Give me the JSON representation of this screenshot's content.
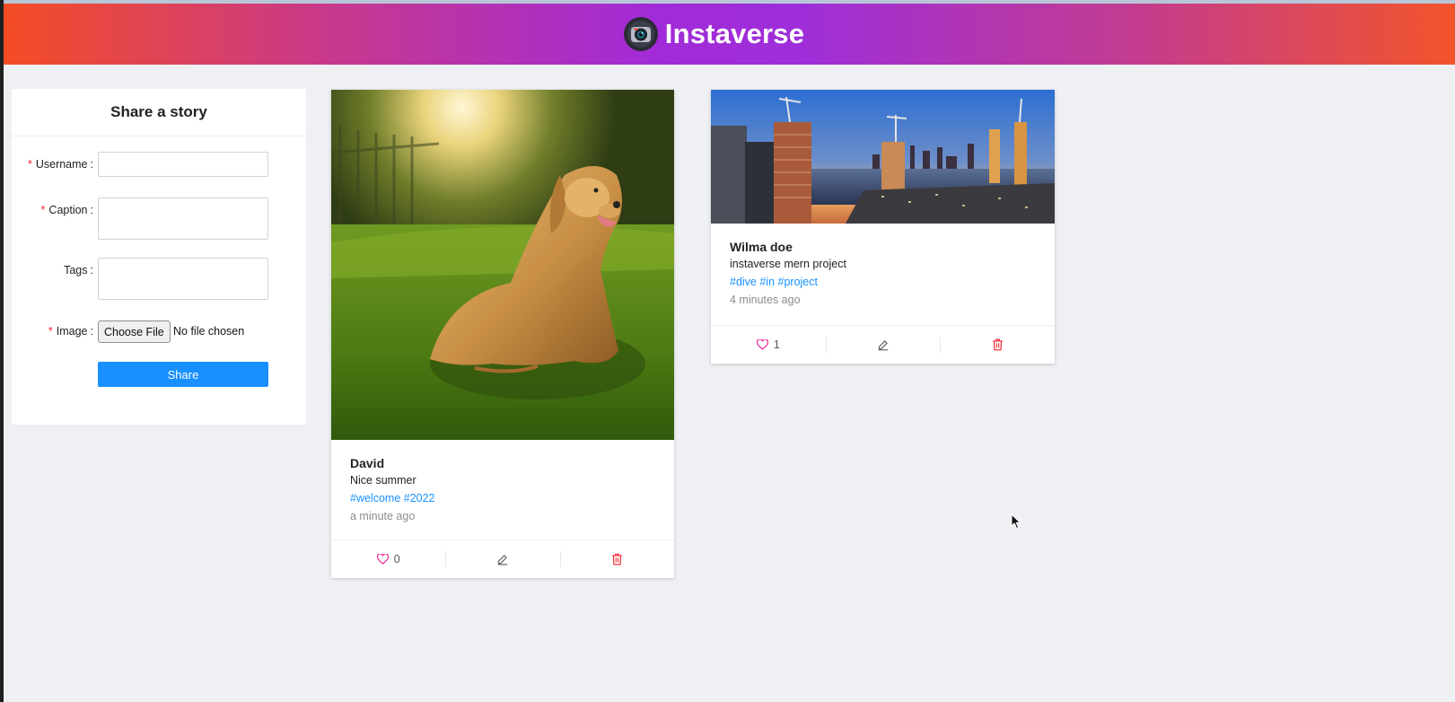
{
  "app": {
    "title": "Instaverse",
    "logo_icon": "camera-lens-icon"
  },
  "form": {
    "title": "Share a story",
    "required_mark": "*",
    "colon": ":",
    "fields": {
      "username": {
        "label": "Username",
        "required": true,
        "value": ""
      },
      "caption": {
        "label": "Caption",
        "required": true,
        "value": ""
      },
      "tags": {
        "label": "Tags",
        "required": false,
        "value": ""
      },
      "image": {
        "label": "Image",
        "required": true,
        "button": "Choose File",
        "status": "No file chosen"
      }
    },
    "submit_label": "Share"
  },
  "posts": [
    {
      "author": "David",
      "caption": "Nice summer",
      "tags": "#welcome #2022",
      "time": "a minute ago",
      "likes": "0",
      "image_subject": "golden retriever lying in grass"
    },
    {
      "author": "Wilma doe",
      "caption": "instaverse mern project",
      "tags": "#dive #in #project",
      "time": "4 minutes ago",
      "likes": "1",
      "image_subject": "city skyline at sunset over river"
    }
  ],
  "icons": {
    "like": "heart-icon",
    "edit": "pencil-icon",
    "delete": "trash-icon"
  },
  "colors": {
    "accent": "#1890ff",
    "danger": "#f5222d",
    "like": "#eb2f96"
  }
}
